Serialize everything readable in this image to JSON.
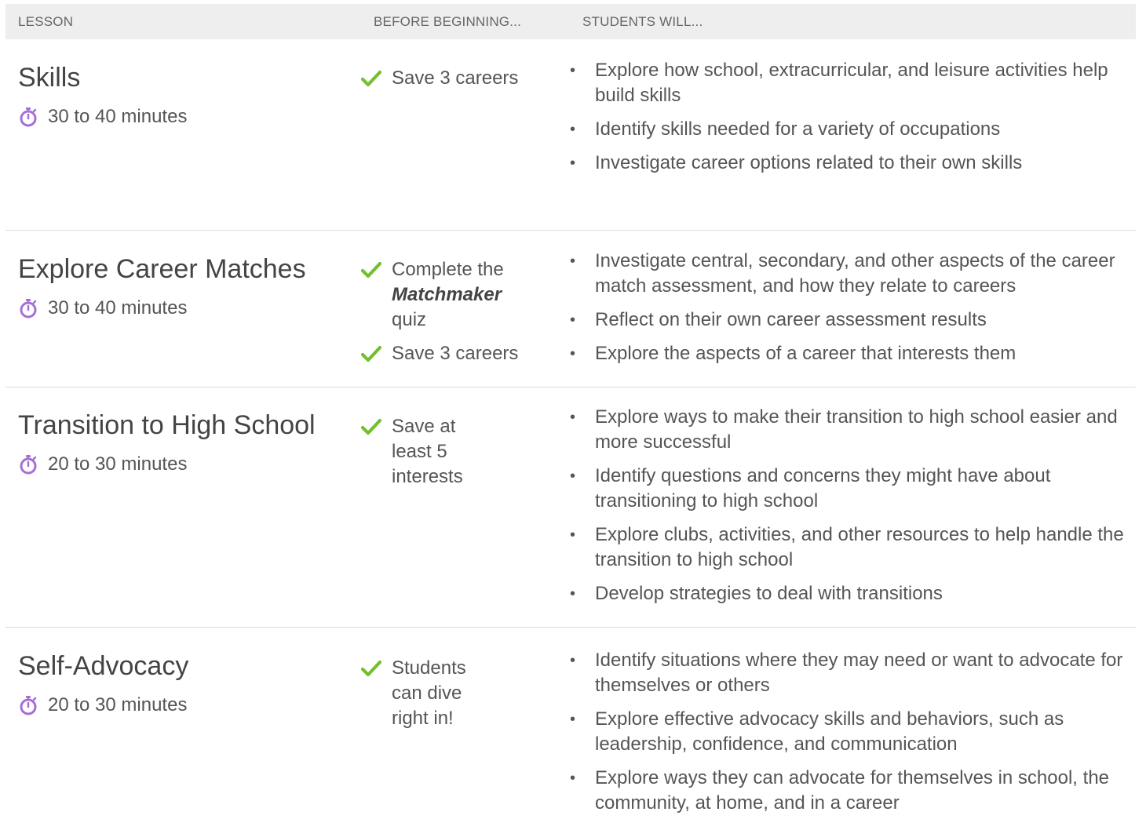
{
  "header": {
    "lesson": "LESSON",
    "before": "BEFORE BEGINNING...",
    "will": "STUDENTS WILL..."
  },
  "colors": {
    "timer": "#a66fd6",
    "check": "#72c02c",
    "header_bg": "#eeeeee"
  },
  "icons": {
    "timer": "stopwatch-icon",
    "check": "checkmark-icon",
    "bullet": "•"
  },
  "lessons": [
    {
      "title": "Skills",
      "duration": "30 to 40 minutes",
      "before": [
        {
          "pre": "",
          "emphasis": "",
          "post": "Save 3 careers"
        }
      ],
      "objectives": [
        "Explore how school, extracurricular, and leisure activities help build skills",
        "Identify skills needed for a variety of occupations",
        "Investigate career options related to their own skills"
      ]
    },
    {
      "title": "Explore Career Matches",
      "duration": "30 to 40 minutes",
      "before": [
        {
          "pre": "Complete the ",
          "emphasis": "Matchmaker",
          "post": " quiz"
        },
        {
          "pre": "",
          "emphasis": "",
          "post": "Save 3 careers"
        }
      ],
      "objectives": [
        "Investigate central, secondary, and other aspects of the career match assessment, and how they relate to careers",
        "Reflect on their own career assessment results",
        "Explore the aspects of a career that interests them"
      ]
    },
    {
      "title": "Transition to High School",
      "duration": "20 to 30 minutes",
      "before": [
        {
          "pre": "",
          "emphasis": "",
          "post": "Save at least 5 interests"
        }
      ],
      "objectives": [
        "Explore ways to make their transition to high school easier and more successful",
        "Identify questions and concerns they might have about transitioning to high school",
        "Explore clubs, activities, and other resources to help handle the transition to high school",
        "Develop strategies to deal with transitions"
      ]
    },
    {
      "title": "Self-Advocacy",
      "duration": "20 to 30 minutes",
      "before": [
        {
          "pre": "",
          "emphasis": "",
          "post": "Students can dive right in!"
        }
      ],
      "objectives": [
        "Identify situations where they may need or want to advocate for themselves or others",
        "Explore effective advocacy skills and behaviors, such as leadership, confidence, and communication",
        "Explore ways they can advocate for themselves in school, the community, at home, and in a career"
      ]
    }
  ]
}
